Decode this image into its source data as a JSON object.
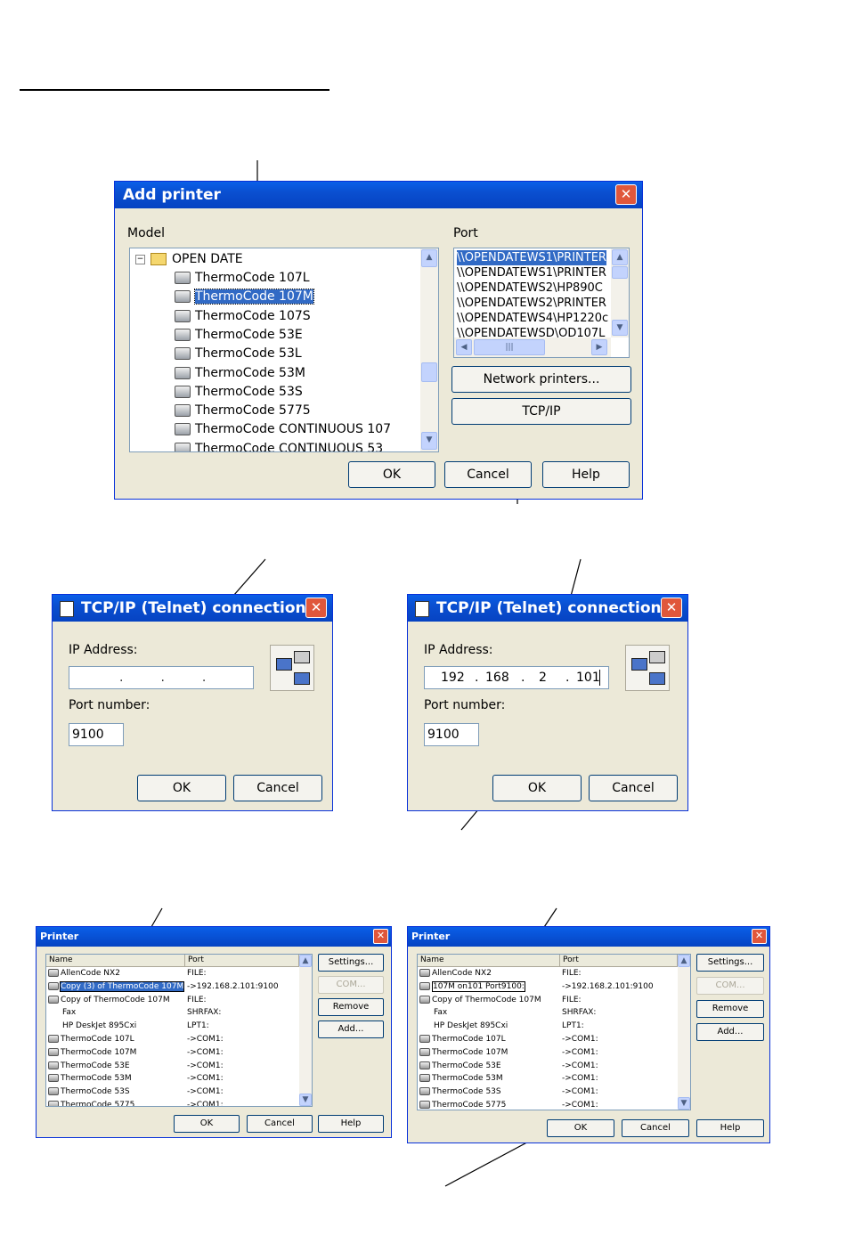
{
  "add_printer": {
    "title": "Add printer",
    "model_label": "Model",
    "port_label": "Port",
    "tree_root": "OPEN DATE",
    "tree_items": [
      "ThermoCode 107L",
      "ThermoCode 107M",
      "ThermoCode 107S",
      "ThermoCode 53E",
      "ThermoCode 53L",
      "ThermoCode 53M",
      "ThermoCode 53S",
      "ThermoCode 5775",
      "ThermoCode CONTINUOUS 107",
      "ThermoCode CONTINUOUS 53"
    ],
    "selected_item": "ThermoCode 107M",
    "ports": [
      "\\\\OPENDATEWS1\\PRINTER",
      "\\\\OPENDATEWS1\\PRINTER",
      "\\\\OPENDATEWS2\\HP890C",
      "\\\\OPENDATEWS2\\PRINTER",
      "\\\\OPENDATEWS4\\HP1220c",
      "\\\\OPENDATEWSD\\OD107L"
    ],
    "network_printers_label": "Network printers...",
    "tcpip_label": "TCP/IP",
    "ok_label": "OK",
    "cancel_label": "Cancel",
    "help_label": "Help"
  },
  "tcp_left": {
    "title": "TCP/IP (Telnet) connection",
    "ip_label": "IP Address:",
    "ip_value": ". . .",
    "port_label": "Port number:",
    "port_value": "9100",
    "ok_label": "OK",
    "cancel_label": "Cancel"
  },
  "tcp_right": {
    "title": "TCP/IP (Telnet) connection",
    "ip_label": "IP Address:",
    "ip_parts": [
      "192",
      "168",
      "2",
      "101"
    ],
    "port_label": "Port number:",
    "port_value": "9100",
    "ok_label": "OK",
    "cancel_label": "Cancel"
  },
  "printer_left": {
    "title": "Printer",
    "col_name": "Name",
    "col_port": "Port",
    "rows": [
      {
        "name": "AllenCode NX2",
        "port": "FILE:"
      },
      {
        "name": "Copy (3) of ThermoCode 107M",
        "port": "->192.168.2.101:9100"
      },
      {
        "name": "Copy of ThermoCode 107M",
        "port": "FILE:"
      },
      {
        "name": "Fax",
        "port": "SHRFAX:"
      },
      {
        "name": "HP DeskJet 895Cxi",
        "port": "LPT1:"
      },
      {
        "name": "ThermoCode 107L",
        "port": "->COM1:"
      },
      {
        "name": "ThermoCode 107M",
        "port": "->COM1:"
      },
      {
        "name": "ThermoCode 53E",
        "port": "->COM1:"
      },
      {
        "name": "ThermoCode 53M",
        "port": "->COM1:"
      },
      {
        "name": "ThermoCode 53S",
        "port": "->COM1:"
      },
      {
        "name": "ThermoCode 5775",
        "port": "->COM1:"
      }
    ],
    "settings_label": "Settings...",
    "com_label": "COM...",
    "remove_label": "Remove",
    "add_label": "Add...",
    "ok_label": "OK",
    "cancel_label": "Cancel",
    "help_label": "Help"
  },
  "printer_right": {
    "title": "Printer",
    "col_name": "Name",
    "col_port": "Port",
    "rows": [
      {
        "name": "AllenCode NX2",
        "port": "FILE:"
      },
      {
        "name": "107M on101 Port9100:",
        "port": "->192.168.2.101:9100"
      },
      {
        "name": "Copy of ThermoCode 107M",
        "port": "FILE:"
      },
      {
        "name": "Fax",
        "port": "SHRFAX:"
      },
      {
        "name": "HP DeskJet 895Cxi",
        "port": "LPT1:"
      },
      {
        "name": "ThermoCode 107L",
        "port": "->COM1:"
      },
      {
        "name": "ThermoCode 107M",
        "port": "->COM1:"
      },
      {
        "name": "ThermoCode 53E",
        "port": "->COM1:"
      },
      {
        "name": "ThermoCode 53M",
        "port": "->COM1:"
      },
      {
        "name": "ThermoCode 53S",
        "port": "->COM1:"
      },
      {
        "name": "ThermoCode 5775",
        "port": "->COM1:"
      }
    ],
    "settings_label": "Settings...",
    "com_label": "COM...",
    "remove_label": "Remove",
    "add_label": "Add...",
    "ok_label": "OK",
    "cancel_label": "Cancel",
    "help_label": "Help"
  },
  "colors": {
    "titlebar": "#0a4fd0",
    "face": "#ece9d8",
    "selection": "#316ac5",
    "close": "#e0573b"
  }
}
